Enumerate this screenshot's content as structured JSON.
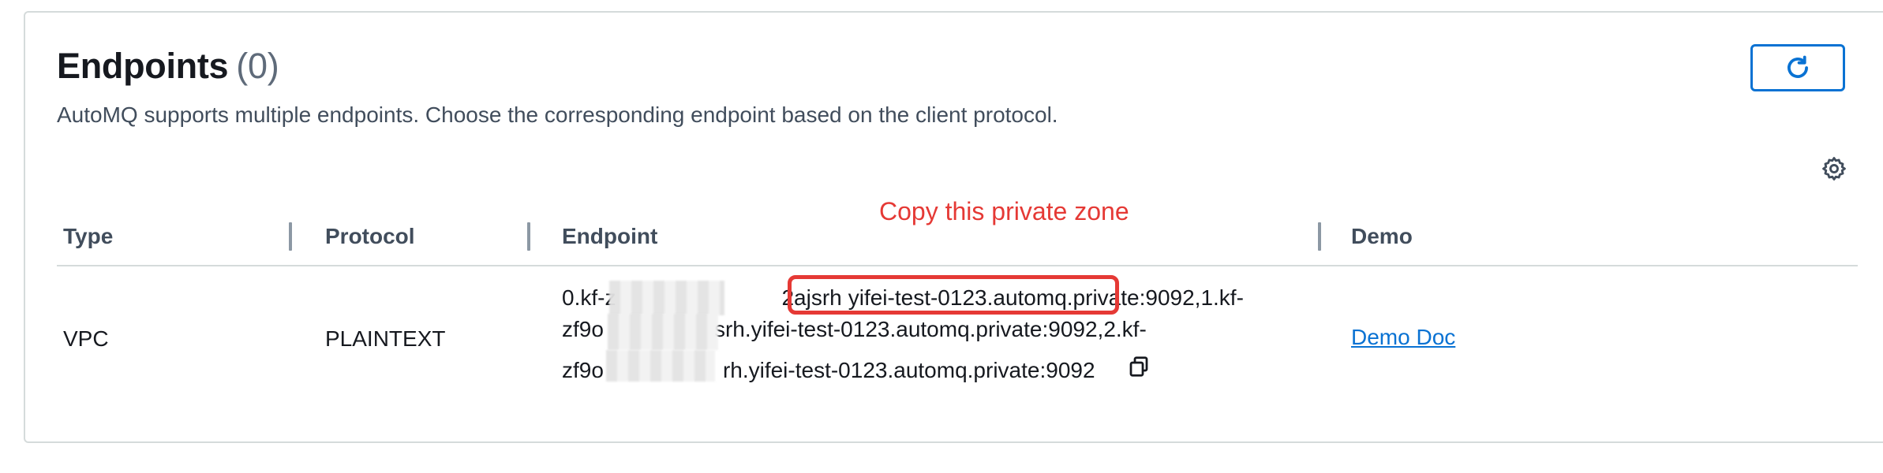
{
  "header": {
    "title": "Endpoints",
    "count": "(0)",
    "description": "AutoMQ supports multiple endpoints. Choose the corresponding endpoint based on the client protocol."
  },
  "table": {
    "columns": [
      "Type",
      "Protocol",
      "Endpoint",
      "Demo"
    ],
    "rows": [
      {
        "type": "VPC",
        "protocol": "PLAINTEXT",
        "endpoint_lines": [
          "0.kf-z 2ajsrh.yifei-test-0123.automq.private:9092,1.kf-",
          "zf9o srh.yifei-test-0123.automq.private:9092,2.kf-",
          "zf9o rh.yifei-test-0123.automq.private:9092"
        ],
        "endpoint_segments": {
          "l1a": "0.kf-z",
          "l1b": "2ajsrh",
          "l1c": "yifei-test-0123.automq.private:",
          "l1d": "9092,1.kf-",
          "l2a": "zf9o",
          "l2b": "srh.yifei-test-0123.automq.private:9092,2.kf-",
          "l3a": "zf9o",
          "l3b": "rh.yifei-test-0123.automq.private:9092"
        },
        "demo_link": "Demo Doc"
      }
    ]
  },
  "annotation": {
    "label": "Copy this private zone",
    "color": "#e53935"
  },
  "icons": {
    "refresh": "refresh-icon",
    "settings": "gear-icon",
    "copy": "copy-icon"
  },
  "colors": {
    "accent": "#0972d3",
    "text": "#16191f",
    "muted": "#5f6b7a"
  }
}
